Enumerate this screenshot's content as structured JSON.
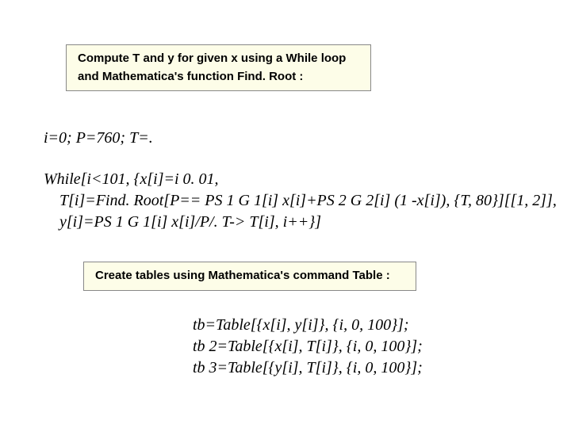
{
  "box1": {
    "line1": "Compute T and y for given x using a While loop",
    "line2": "and Mathematica's function Find. Root :"
  },
  "code_init": "i=0; P=760; T=.",
  "code_while": "While[i<101, {x[i]=i 0. 01,\n    T[i]=Find. Root[P== PS 1 G 1[i] x[i]+PS 2 G 2[i] (1 -x[i]), {T, 80}][[1, 2]],\n    y[i]=PS 1 G 1[i] x[i]/P/. T-> T[i], i++}]",
  "box2": {
    "line": "Create tables using Mathematica's command Table :"
  },
  "code_tables": "tb=Table[{x[i], y[i]}, {i, 0, 100}];\ntb 2=Table[{x[i], T[i]}, {i, 0, 100}];\ntb 3=Table[{y[i], T[i]}, {i, 0, 100}];"
}
